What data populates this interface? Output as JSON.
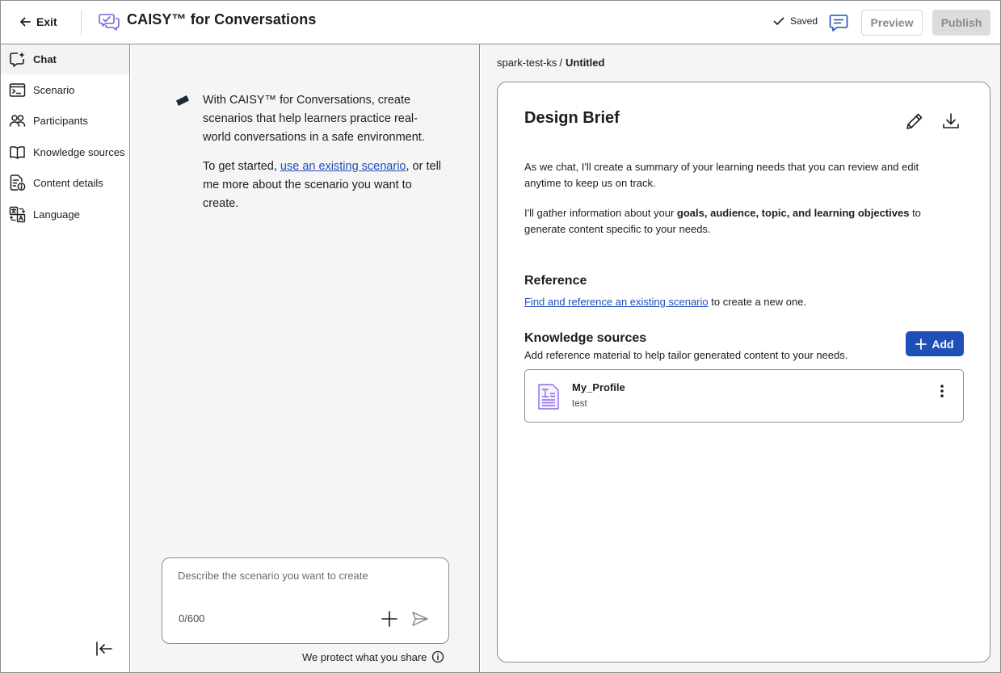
{
  "header": {
    "exit_label": "Exit",
    "app_title": "CAISY™ for Conversations",
    "saved_label": "Saved",
    "preview_label": "Preview",
    "publish_label": "Publish"
  },
  "sidebar": {
    "items": [
      {
        "label": "Chat",
        "icon": "chat-sparkle-icon",
        "active": true
      },
      {
        "label": "Scenario",
        "icon": "terminal-window-icon"
      },
      {
        "label": "Participants",
        "icon": "people-icon"
      },
      {
        "label": "Knowledge sources",
        "icon": "book-open-icon"
      },
      {
        "label": "Content details",
        "icon": "document-info-icon"
      },
      {
        "label": "Language",
        "icon": "translate-icon"
      }
    ]
  },
  "chat": {
    "intro_line1": "With CAISY™ for Conversations, create scenarios that help learners practice real-world conversations in a safe environment.",
    "intro_prefix": "To get started, ",
    "intro_link": "use an existing scenario",
    "intro_suffix": ", or tell me more about the scenario you want to create.",
    "input_placeholder": "Describe the scenario you want to create",
    "input_value": "",
    "counter": "0/600",
    "protect_note": "We protect what you share"
  },
  "brief": {
    "breadcrumb_parent": "spark-test-ks",
    "breadcrumb_sep": "/",
    "breadcrumb_current": "Untitled",
    "title": "Design Brief",
    "para1": "As we chat, I'll create a summary of your learning needs that you can review and edit anytime to keep us on track.",
    "para2_prefix": "I'll gather information about your ",
    "para2_bold": "goals, audience, topic, and learning objectives",
    "para2_suffix": " to generate content specific to your needs.",
    "reference_title": "Reference",
    "reference_link": "Find and reference an existing scenario",
    "reference_suffix": " to create a new one.",
    "ks_title": "Knowledge sources",
    "ks_desc": "Add reference material to help tailor generated content to your needs.",
    "add_label": "Add",
    "sources": [
      {
        "name": "My_Profile",
        "desc": "test",
        "icon": "text-document-icon"
      }
    ]
  },
  "colors": {
    "accent": "#1f4fb8",
    "brand_purple": "#7b5fe0",
    "panel_bg": "#f5f5f6"
  }
}
